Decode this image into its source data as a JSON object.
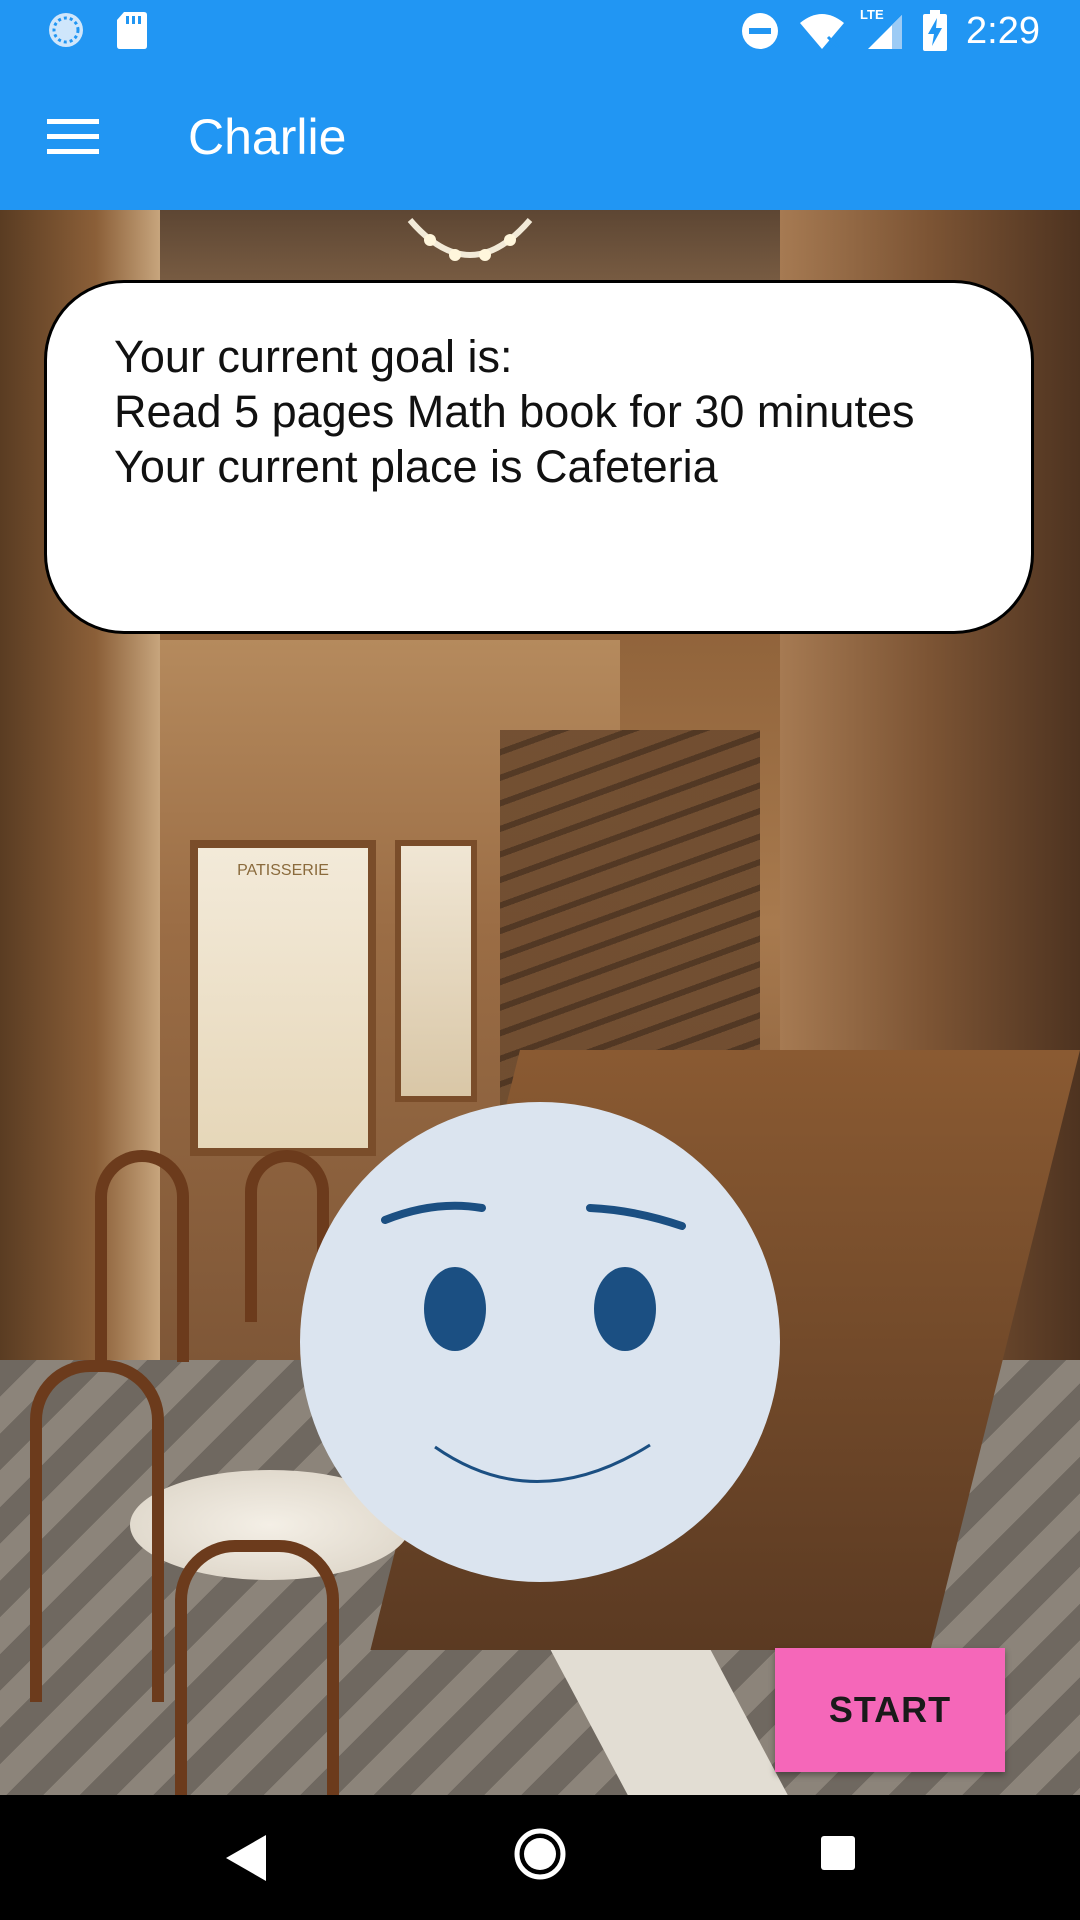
{
  "status_bar": {
    "time": "2:29",
    "icons": [
      "sync-icon",
      "sd-card-icon",
      "do-not-disturb-icon",
      "wifi-icon",
      "lte-signal-icon",
      "battery-charging-icon"
    ],
    "network_label": "LTE"
  },
  "app_bar": {
    "title": "Charlie",
    "menu_icon": "hamburger-menu-icon",
    "color": "#2196F3"
  },
  "bubble": {
    "line1": "Your current goal is:",
    "line2": "Read 5 pages Math book for 30 minutes",
    "line3": "Your current place is Cafeteria"
  },
  "background": {
    "scene": "cafeteria",
    "sign_text": "PATISSERIE"
  },
  "face": {
    "expression": "smile",
    "fill_color": "#dbe4ef",
    "feature_color": "#1b4f82"
  },
  "start_button": {
    "label": "START",
    "color": "#f567b9"
  },
  "nav_bar": {
    "buttons": [
      "back-icon",
      "home-icon",
      "recents-icon"
    ]
  }
}
